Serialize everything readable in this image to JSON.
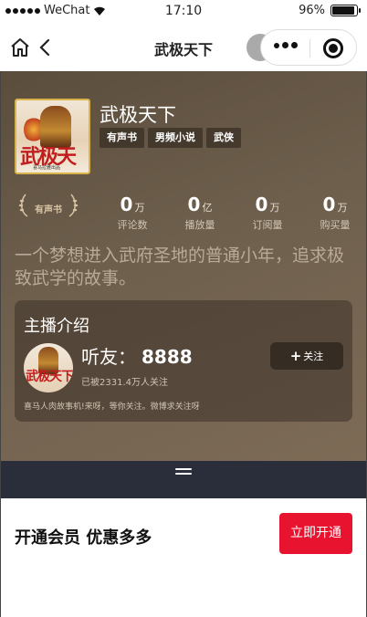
{
  "status_bar": {
    "carrier": "WeChat",
    "time": "17:10",
    "battery_percent": "96%",
    "battery_level": 0.96
  },
  "nav": {
    "title": "武极天下",
    "icons": [
      "home-icon",
      "back-arrow-icon",
      "more-icon",
      "target-icon"
    ]
  },
  "book": {
    "title": "武极天下",
    "tags": [
      "有声书",
      "男频小说",
      "武侠"
    ],
    "cover_title": "武极天下",
    "cover_subtitle": "喜马拉雅出品",
    "badge": "有声书",
    "stats": [
      {
        "value": "0",
        "unit": "万",
        "label": "评论数"
      },
      {
        "value": "0",
        "unit": "亿",
        "label": "播放量"
      },
      {
        "value": "0",
        "unit": "万",
        "label": "订阅量"
      },
      {
        "value": "0",
        "unit": "万",
        "label": "购买量"
      }
    ],
    "description": "一个梦想进入武府圣地的普通小年，追求极致武学的故事。"
  },
  "host": {
    "heading": "主播介绍",
    "name_prefix": "听友：",
    "name_number": "8888",
    "followers": "已被2331.4万人关注",
    "follow_label": "关注",
    "intro": "喜马人肉故事机!来呀，等你关注。微博求关注呀"
  },
  "vip": {
    "text": "开通会员 优惠多多",
    "button_label": "立即开通",
    "button_color": "#e8142f"
  },
  "colors": {
    "hero_bg": "#6e5f4d",
    "strip_bg": "#2a2e3a"
  }
}
